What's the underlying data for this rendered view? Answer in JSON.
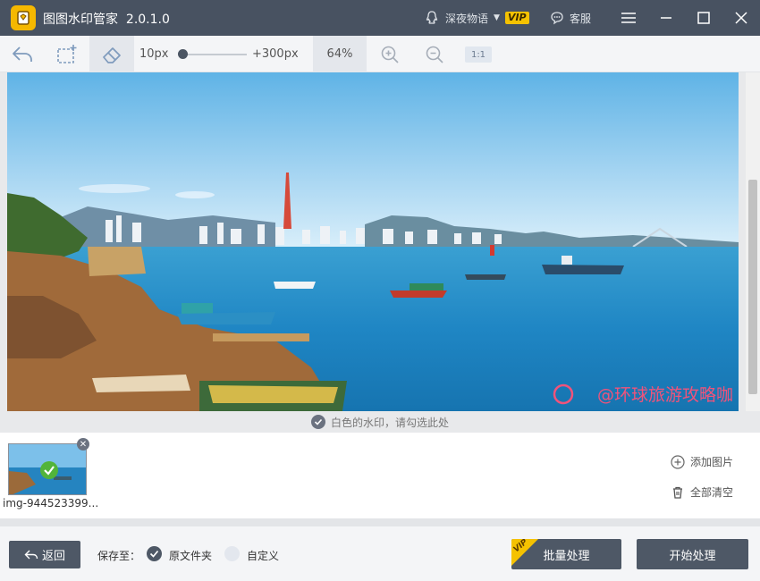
{
  "titlebar": {
    "app_name": "图图水印管家",
    "version": "2.0.1.0",
    "username": "深夜物语",
    "vip_badge": "VIP",
    "service_label": "客服"
  },
  "toolbar": {
    "min_brush": "10px",
    "max_brush": "+300px",
    "zoom": "64%",
    "ratio_label": "1:1",
    "brush_level": 0.0
  },
  "canvas": {
    "watermark_text": "@环球旅游攻略咖",
    "hint": "白色的水印，请勾选此处"
  },
  "thumbnails": {
    "items": [
      {
        "name": "img-944523399...",
        "selected": true
      }
    ]
  },
  "side_actions": {
    "add_image": "添加图片",
    "clear_all": "全部清空"
  },
  "bottombar": {
    "back_label": "返回",
    "save_to_label": "保存至：",
    "option_original": "原文件夹",
    "option_custom": "自定义",
    "batch_label": "批量处理",
    "batch_vip": "VIP",
    "start_label": "开始处理"
  },
  "colors": {
    "titlebar_bg": "#485261",
    "button_bg": "#4e5866",
    "vip_gold": "#f5c200",
    "check_green": "#52b43a"
  }
}
